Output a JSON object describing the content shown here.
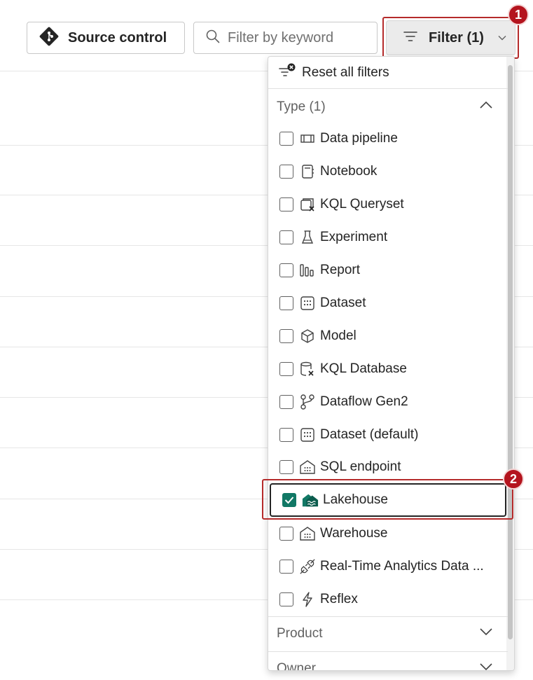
{
  "toolbar": {
    "source_control_label": "Source control",
    "search_placeholder": "Filter by keyword",
    "filter_label": "Filter (1)"
  },
  "callouts": [
    "1",
    "2"
  ],
  "panel": {
    "reset_label": "Reset all filters",
    "type_section": {
      "label": "Type (1)",
      "options": [
        {
          "label": "Data pipeline",
          "icon": "pipeline-icon",
          "checked": false
        },
        {
          "label": "Notebook",
          "icon": "notebook-icon",
          "checked": false
        },
        {
          "label": "KQL Queryset",
          "icon": "kql-queryset-icon",
          "checked": false
        },
        {
          "label": "Experiment",
          "icon": "flask-icon",
          "checked": false
        },
        {
          "label": "Report",
          "icon": "report-icon",
          "checked": false
        },
        {
          "label": "Dataset",
          "icon": "dataset-icon",
          "checked": false
        },
        {
          "label": "Model",
          "icon": "cube-icon",
          "checked": false
        },
        {
          "label": "KQL Database",
          "icon": "kql-database-icon",
          "checked": false
        },
        {
          "label": "Dataflow Gen2",
          "icon": "dataflow-icon",
          "checked": false
        },
        {
          "label": "Dataset (default)",
          "icon": "dataset-icon",
          "checked": false
        },
        {
          "label": "SQL endpoint",
          "icon": "warehouse-icon",
          "checked": false
        },
        {
          "label": "Lakehouse",
          "icon": "lakehouse-icon",
          "checked": true
        },
        {
          "label": "Warehouse",
          "icon": "warehouse-icon",
          "checked": false
        },
        {
          "label": "Real-Time Analytics Data ...",
          "icon": "plug-icon",
          "checked": false
        },
        {
          "label": "Reflex",
          "icon": "lightning-icon",
          "checked": false
        }
      ]
    },
    "product_section": {
      "label": "Product"
    },
    "owner_section": {
      "label": "Owner"
    }
  },
  "colors": {
    "accent_checked": "#117865",
    "callout_red": "#b4141e"
  }
}
